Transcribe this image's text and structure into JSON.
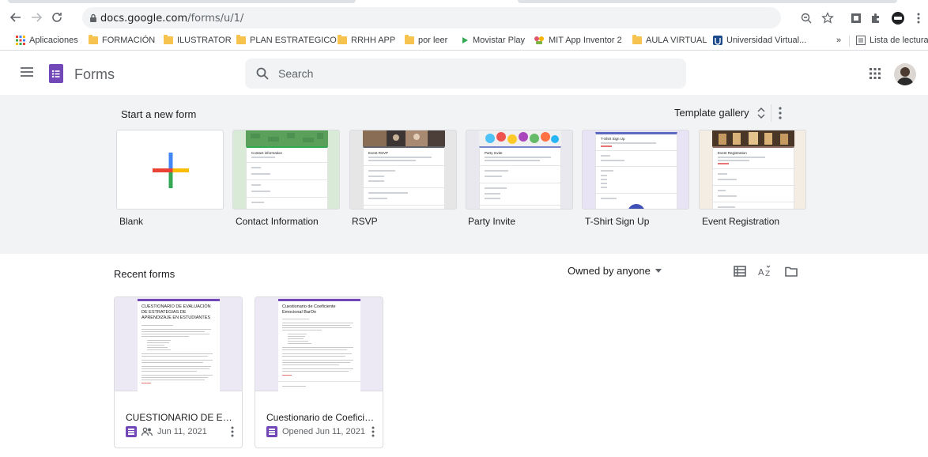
{
  "browser": {
    "url_host": "docs.google.com",
    "url_path": "/forms/u/1/",
    "bookmarks": [
      "Aplicaciones",
      "FORMACIÓN",
      "ILUSTRATOR",
      "PLAN ESTRATEGICO",
      "RRHH APP",
      "por leer",
      "Movistar Play",
      "MIT App Inventor 2",
      "AULA VIRTUAL",
      "Universidad Virtual...",
      "Lista de lectura"
    ],
    "overflow": "»"
  },
  "app": {
    "title": "Forms",
    "search_placeholder": "Search",
    "brand_color": "#7248b9"
  },
  "templates": {
    "heading": "Start a new form",
    "gallery_label": "Template gallery",
    "items": [
      {
        "label": "Blank"
      },
      {
        "label": "Contact Information"
      },
      {
        "label": "RSVP"
      },
      {
        "label": "Party Invite"
      },
      {
        "label": "T-Shirt Sign Up"
      },
      {
        "label": "Event Registration"
      }
    ],
    "thumb_titles": [
      "Contact information",
      "Event RSVP",
      "Party Invite",
      "T-Shirt Sign Up",
      "Event Registration"
    ]
  },
  "recent": {
    "heading": "Recent forms",
    "owner_filter": "Owned by anyone",
    "forms": [
      {
        "name": "CUESTIONARIO DE EVAL...",
        "thumb_title": "CUESTIONARIO DE EVALUACIÓN DE ESTRATEGIAS DE APRENDIZAJE EN ESTUDIANTES",
        "date": "Jun 11, 2021",
        "shared": true
      },
      {
        "name": "Cuestionario de Coeficie...",
        "thumb_title": "Cuestionario de Coeficiente Emocional BarOn",
        "date": "Opened Jun 11, 2021",
        "shared": false
      }
    ]
  }
}
